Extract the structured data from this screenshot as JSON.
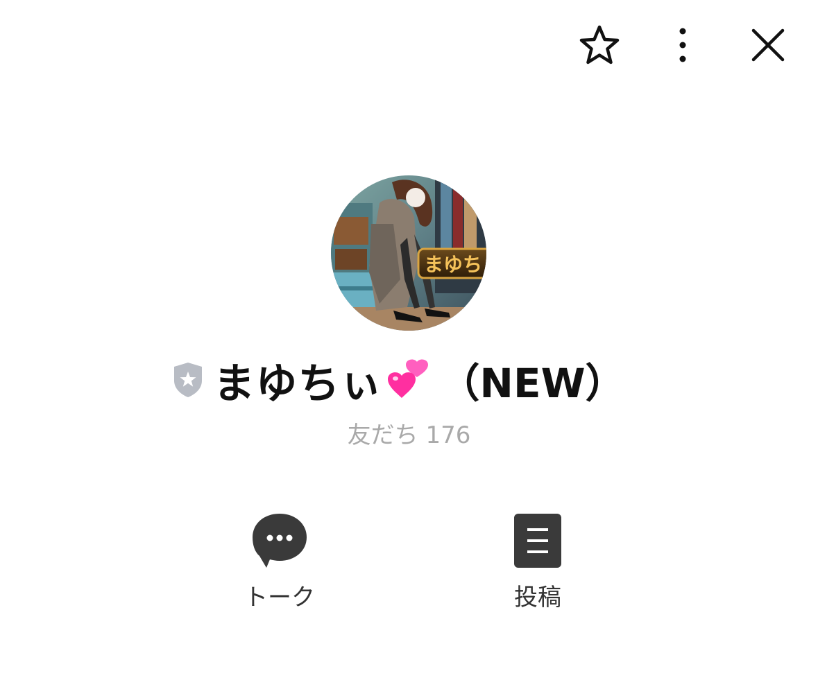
{
  "header": {
    "favorite_icon": "star-outline-icon",
    "more_icon": "vertical-dots-icon",
    "close_icon": "close-x-icon"
  },
  "profile": {
    "avatar_text": "まゆち",
    "badge_icon": "shield-star-icon",
    "name": "まゆちぃ",
    "name_emoji_icon": "two-hearts-icon",
    "name_suffix": "（NEW）",
    "friends_label": "友だち 176"
  },
  "actions": [
    {
      "label": "トーク",
      "icon": "chat-bubble-icon"
    },
    {
      "label": "投稿",
      "icon": "post-list-icon"
    }
  ],
  "colors": {
    "text": "#111111",
    "muted": "#a9a9a9",
    "icon_dark": "#3a3a3a",
    "badge": "#b8bcc4",
    "heart": "#ff3aa6"
  }
}
